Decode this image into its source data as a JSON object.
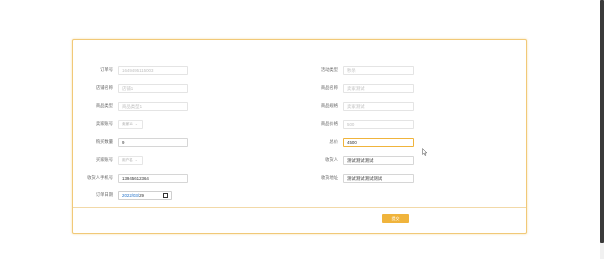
{
  "form": {
    "left": [
      {
        "label": "订单号",
        "value": "1649495115003",
        "kind": "input-disabled"
      },
      {
        "label": "店铺名称",
        "value": "店铺1",
        "kind": "input-disabled"
      },
      {
        "label": "商品类型",
        "value": "商品类型1",
        "kind": "input-disabled"
      },
      {
        "label": "卖家账号",
        "value": "卖家11",
        "kind": "select"
      },
      {
        "label": "购买数量",
        "value": "9",
        "kind": "input"
      },
      {
        "label": "买家账号",
        "value": "用户名",
        "kind": "select"
      },
      {
        "label": "收货人手机号",
        "value": "13945612364",
        "kind": "input"
      },
      {
        "label": "订单日期",
        "value_prefix": "2022/03/",
        "value_suffix": "29",
        "kind": "date"
      }
    ],
    "right": [
      {
        "label": "活动类型",
        "value": "秒杀",
        "kind": "input-disabled"
      },
      {
        "label": "商品名称",
        "value": "卖家测试",
        "kind": "input-disabled"
      },
      {
        "label": "商品规格",
        "value": "卖家测试",
        "kind": "input-disabled"
      },
      {
        "label": "商品价格",
        "value": "500",
        "kind": "input-disabled"
      },
      {
        "label": "总价",
        "value": "4500",
        "kind": "input-focus"
      },
      {
        "label": "收货人",
        "value": "测试测试测试",
        "kind": "input"
      },
      {
        "label": "收货地址",
        "value": "测试测试测试测试",
        "kind": "input"
      }
    ],
    "submit_label": "提交",
    "select_chevron": "⌄"
  },
  "colors": {
    "accent": "#f0b43c",
    "card_border": "#f1c978",
    "date_text": "#1e6fc8"
  },
  "icons": {
    "calendar": "calendar-icon",
    "cursor": "mouse-pointer-icon"
  }
}
